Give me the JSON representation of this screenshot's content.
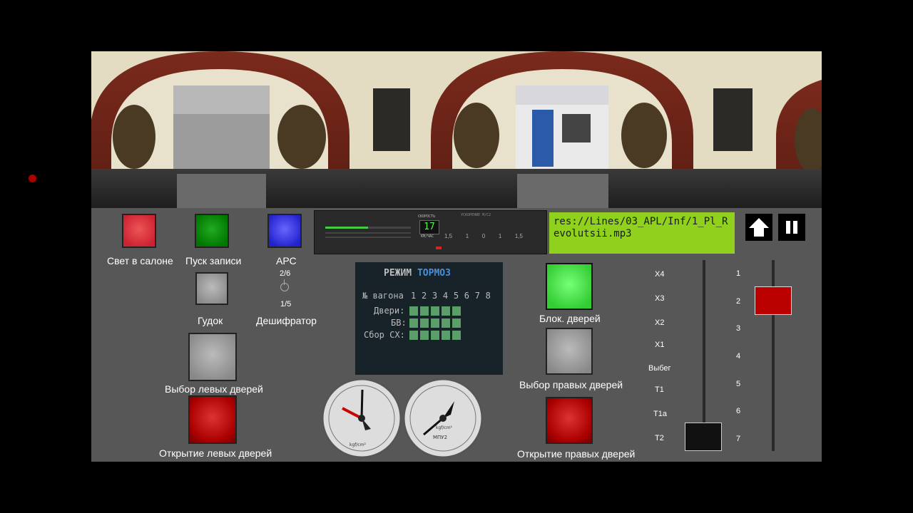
{
  "buttons": {
    "salon_light": "Свет в салоне",
    "start_record": "Пуск записи",
    "ars": "АРС",
    "horn": "Гудок",
    "decoder": "Дешифратор",
    "decoder_top": "2/6",
    "decoder_bottom": "1/5",
    "left_doors_select": "Выбор левых дверей",
    "left_doors_open": "Открытие левых дверей",
    "block_doors": "Блок. дверей",
    "right_doors_select": "Выбор правых дверей",
    "right_doors_open": "Открытие правых дверей"
  },
  "audio_path": "res://Lines/03_APL/Inf/1_Pl_Revolutsii.mp3",
  "speed_display": "17",
  "speed_unit": "КМ/ЧАС",
  "speed_caption": "СКОРОСТЬ",
  "accel_caption": "УСКОРЕНИЕ М/С2",
  "accel_scale": [
    "1,5",
    "1",
    "0",
    "1",
    "1,5"
  ],
  "status_panel": {
    "mode_label": "РЕЖИМ",
    "mode_value": "ТОРМОЗ",
    "wagon_label": "№ вагона",
    "wagons": [
      "1",
      "2",
      "3",
      "4",
      "5",
      "6",
      "7",
      "8"
    ],
    "rows": [
      "Двери:",
      "БВ:",
      "Сбор СХ:"
    ]
  },
  "controller_positions": [
    "X4",
    "X3",
    "X2",
    "X1",
    "Выбег",
    "T1",
    "T1a",
    "T2"
  ],
  "crane_positions": [
    "1",
    "2",
    "3",
    "4",
    "5",
    "6",
    "7"
  ],
  "gauges": {
    "left_unit": "kgf/cm²",
    "right_label": "МПУ2",
    "right_unit": "kgf/cm²"
  },
  "colors": {
    "display_green": "#8fd11c",
    "panel": "#575757"
  }
}
